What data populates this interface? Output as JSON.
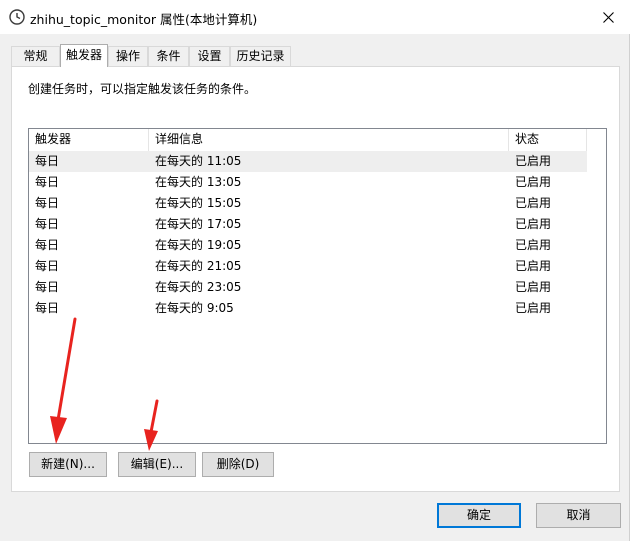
{
  "window": {
    "title": "zhihu_topic_monitor 属性(本地计算机)",
    "icon": "clock-icon"
  },
  "tabs": [
    {
      "label": "常规",
      "active": false
    },
    {
      "label": "触发器",
      "active": true
    },
    {
      "label": "操作",
      "active": false
    },
    {
      "label": "条件",
      "active": false
    },
    {
      "label": "设置",
      "active": false
    },
    {
      "label": "历史记录",
      "active": false
    }
  ],
  "panel": {
    "hint": "创建任务时，可以指定触发该任务的条件。"
  },
  "listview": {
    "columns": [
      "触发器",
      "详细信息",
      "状态"
    ],
    "rows": [
      {
        "trigger": "每日",
        "detail": "在每天的 11:05",
        "status": "已启用"
      },
      {
        "trigger": "每日",
        "detail": "在每天的 13:05",
        "status": "已启用"
      },
      {
        "trigger": "每日",
        "detail": "在每天的 15:05",
        "status": "已启用"
      },
      {
        "trigger": "每日",
        "detail": "在每天的 17:05",
        "status": "已启用"
      },
      {
        "trigger": "每日",
        "detail": "在每天的 19:05",
        "status": "已启用"
      },
      {
        "trigger": "每日",
        "detail": "在每天的 21:05",
        "status": "已启用"
      },
      {
        "trigger": "每日",
        "detail": "在每天的 23:05",
        "status": "已启用"
      },
      {
        "trigger": "每日",
        "detail": "在每天的 9:05",
        "status": "已启用"
      }
    ]
  },
  "buttons": {
    "new": "新建(N)...",
    "edit": "编辑(E)...",
    "delete": "删除(D)",
    "ok": "确定",
    "cancel": "取消"
  },
  "colors": {
    "annotation_arrow": "#e8231f",
    "default_button_border": "#0078d7"
  }
}
